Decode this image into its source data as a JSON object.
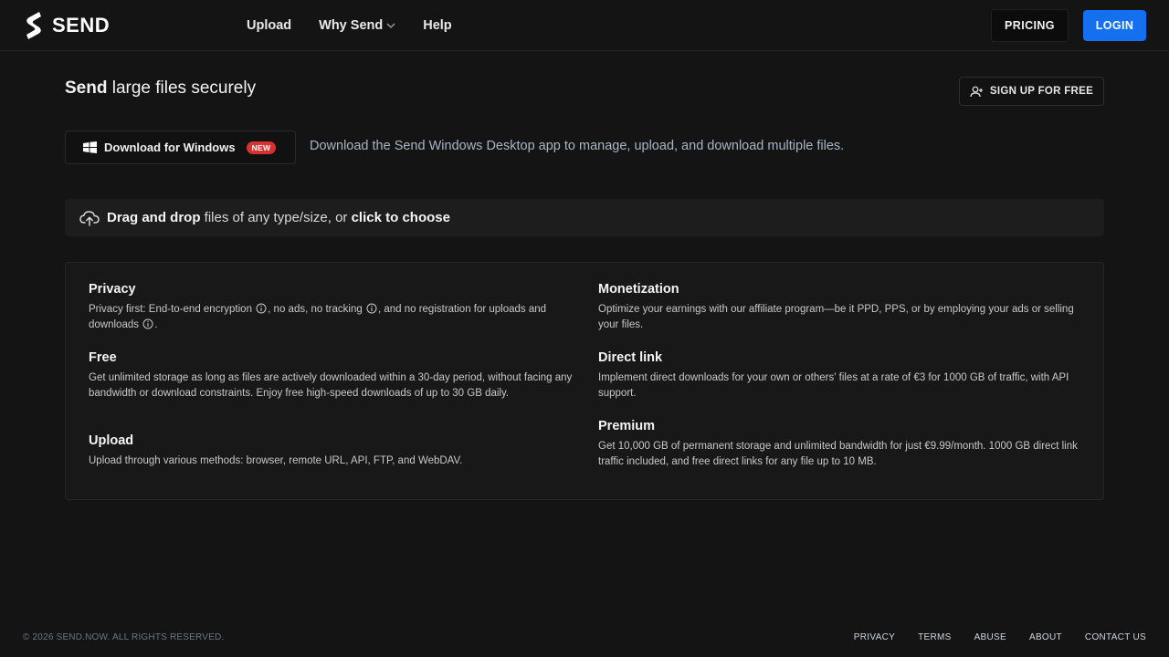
{
  "header": {
    "brand": "SEND",
    "nav": [
      {
        "label": "Upload"
      },
      {
        "label": "Why Send"
      },
      {
        "label": "Help"
      }
    ],
    "pricing_label": "PRICING",
    "login_label": "LOGIN"
  },
  "hero": {
    "title_strong": "Send",
    "title_rest": " large files securely",
    "signup_label": "SIGN UP FOR FREE"
  },
  "download": {
    "button_label": "Download for Windows",
    "badge": "NEW",
    "description": "Download the Send Windows Desktop app to manage, upload, and download multiple files."
  },
  "dropzone": {
    "strong1": "Drag and drop",
    "middle": " files of any type/size, or ",
    "strong2": "click to choose"
  },
  "features": {
    "privacy": {
      "title": "Privacy",
      "part1": "Privacy first: End-to-end encryption",
      "part2": ", no ads, no tracking",
      "part3": ", and no registration for uploads and downloads",
      "part4": "."
    },
    "free": {
      "title": "Free",
      "text": "Get unlimited storage as long as files are actively downloaded within a 30-day period, without facing any bandwidth or download constraints. Enjoy free high-speed downloads of up to 30 GB daily."
    },
    "upload": {
      "title": "Upload",
      "text": "Upload through various methods: browser, remote URL, API, FTP, and WebDAV."
    },
    "monetization": {
      "title": "Monetization",
      "text": "Optimize your earnings with our affiliate program—be it PPD, PPS, or by employing your ads or selling your files."
    },
    "direct_link": {
      "title": "Direct link",
      "text": "Implement direct downloads for your own or others' files at a rate of €3 for 1000 GB of traffic, with API support."
    },
    "premium": {
      "title": "Premium",
      "text": "Get 10,000 GB of permanent storage and unlimited bandwidth for just €9.99/month. 1000 GB direct link traffic included, and free direct links for any file up to 10 MB."
    }
  },
  "footer": {
    "copyright": "© 2026 SEND.NOW. ALL RIGHTS RESERVED.",
    "links": [
      {
        "label": "PRIVACY"
      },
      {
        "label": "TERMS"
      },
      {
        "label": "ABUSE"
      },
      {
        "label": "ABOUT"
      },
      {
        "label": "CONTACT US"
      }
    ]
  },
  "icons": {
    "logo": "send-logo-icon",
    "chevron": "chevron-down-icon",
    "signup": "user-plus-icon",
    "windows": "windows-icon",
    "upload": "cloud-upload-icon",
    "info": "info-icon"
  },
  "colors": {
    "background": "#141414",
    "accent": "#1570ef",
    "badge": "#d63232",
    "muted_text": "#a9b5c5"
  }
}
